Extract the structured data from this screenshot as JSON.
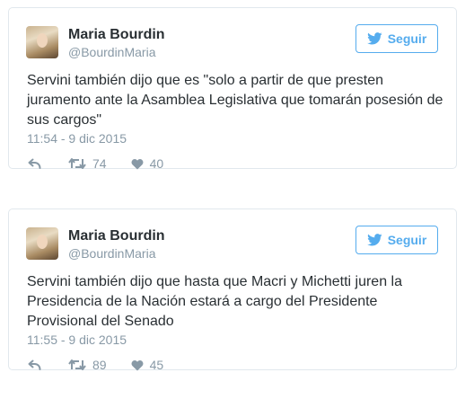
{
  "tweets": [
    {
      "author": {
        "name": "Maria Bourdin",
        "handle": "@BourdinMaria"
      },
      "follow_label": "Seguir",
      "text": "Servini también dijo que es \"solo a partir de que presten juramento ante la Asamblea Legislativa que tomarán posesión de sus cargos\"",
      "timestamp": "11:54 - 9 dic 2015",
      "retweets": "74",
      "likes": "40"
    },
    {
      "author": {
        "name": "Maria Bourdin",
        "handle": "@BourdinMaria"
      },
      "follow_label": "Seguir",
      "text": "Servini también dijo que hasta que Macri y Michetti juren la Presidencia de la Nación estará a cargo del Presidente Provisional del Senado",
      "timestamp": "11:55 - 9 dic 2015",
      "retweets": "89",
      "likes": "45"
    }
  ],
  "colors": {
    "accent": "#55acee",
    "muted": "#8899a6",
    "text": "#292f33",
    "border": "#e1e8ed"
  },
  "icons": {
    "follow": "twitter-bird-icon",
    "reply": "reply-icon",
    "retweet": "retweet-icon",
    "like": "heart-icon"
  }
}
